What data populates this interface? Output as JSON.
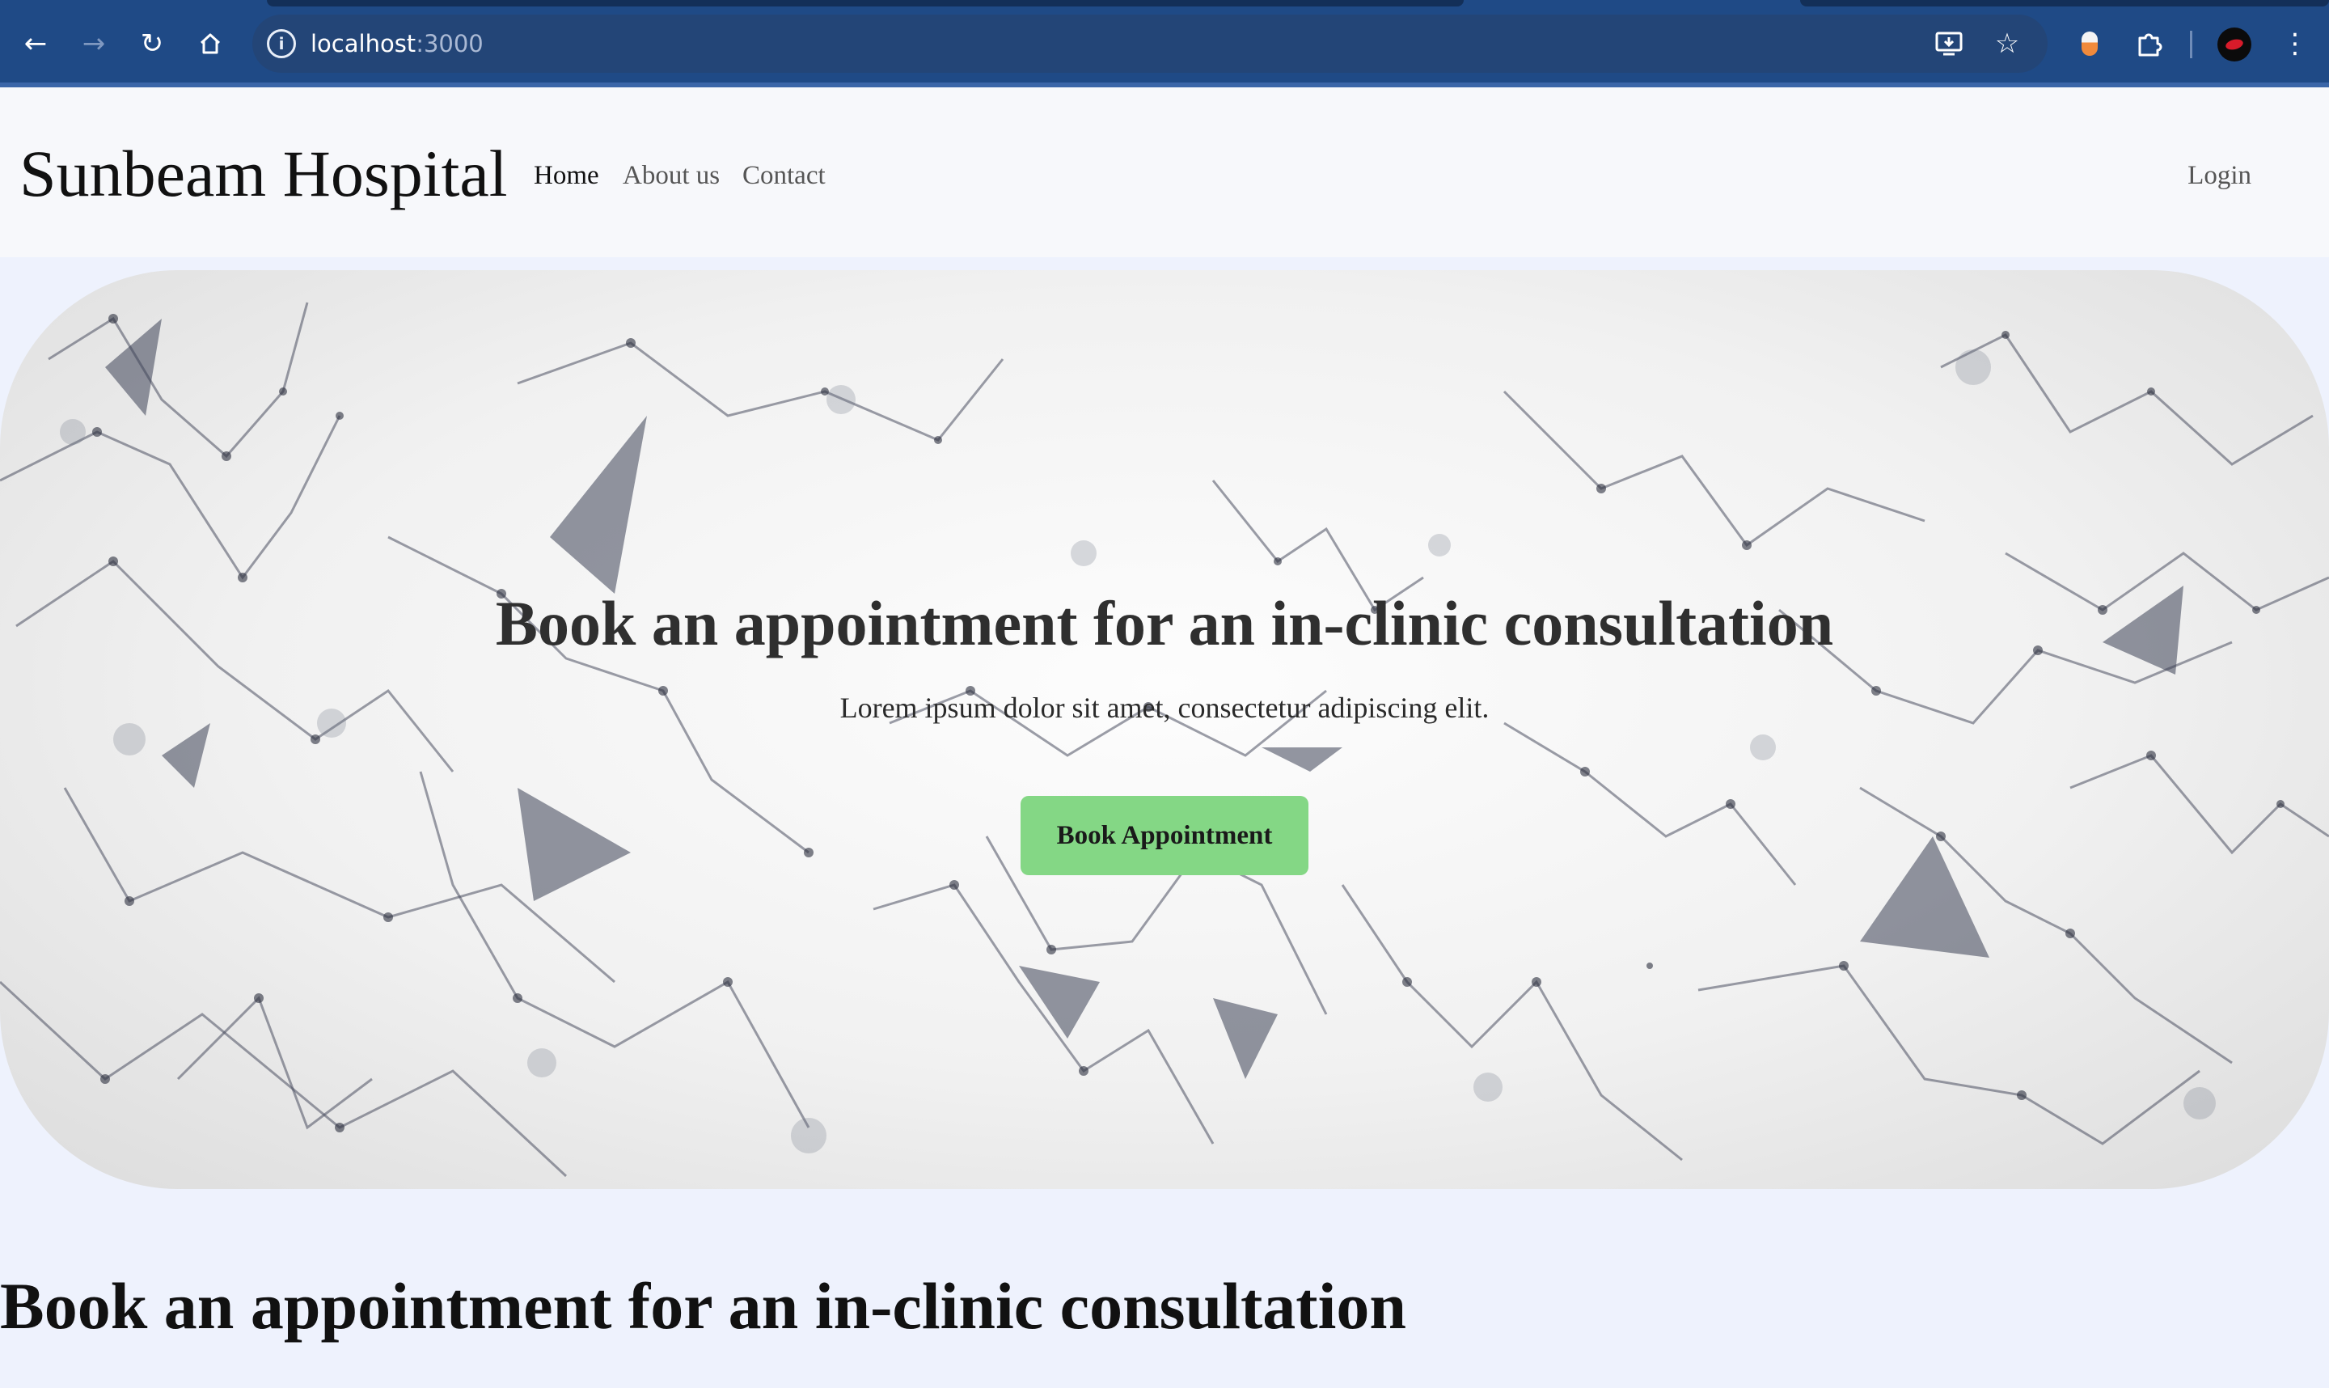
{
  "browser": {
    "url_host": "localhost",
    "url_port": ":3000",
    "icons": {
      "back": "arrow-left-icon",
      "forward": "arrow-right-icon",
      "reload": "reload-icon",
      "home": "home-icon",
      "site_info": "info-icon",
      "install": "install-app-icon",
      "bookmark": "star-icon",
      "extension": "extension-icon",
      "menu": "kebab-menu-icon"
    }
  },
  "header": {
    "brand": "Sunbeam Hospital",
    "nav": [
      {
        "label": "Home",
        "active": true
      },
      {
        "label": "About us",
        "active": false
      },
      {
        "label": "Contact",
        "active": false
      }
    ],
    "login": "Login"
  },
  "hero": {
    "title": "Book an appointment for an in-clinic consultation",
    "subtitle": "Lorem ipsum dolor sit amet, consectetur adipiscing elit.",
    "cta_label": "Book Appointment"
  },
  "section": {
    "heading": "Book an appointment for an in-clinic consultation"
  },
  "colors": {
    "chrome": "#1f4a86",
    "page_bg": "#eef2fd",
    "header_bg": "#f7f8fb",
    "cta_green": "#84d785"
  }
}
